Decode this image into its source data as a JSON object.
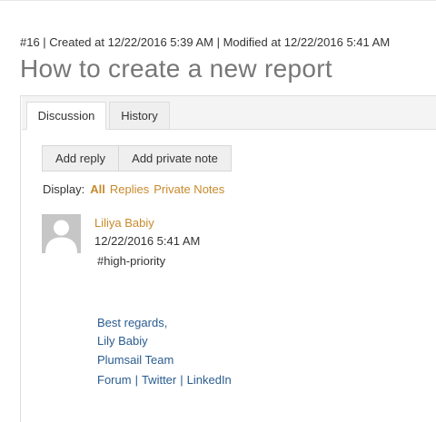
{
  "ticket": {
    "meta": "#16 | Created at 12/22/2016 5:39 AM | Modified at 12/22/2016 5:41 AM",
    "title": "How to create a new report"
  },
  "tabs": [
    {
      "label": "Discussion",
      "active": true
    },
    {
      "label": "History",
      "active": false
    }
  ],
  "actions": {
    "add_reply": "Add reply",
    "add_private_note": "Add private note"
  },
  "filter": {
    "label": "Display:",
    "options": [
      "All",
      "Replies",
      "Private Notes"
    ],
    "selected": "All"
  },
  "comment": {
    "author": "Liliya Babiy",
    "timestamp": "12/22/2016 5:41 AM",
    "body": "#high-priority",
    "signature": {
      "line1": "Best regards,",
      "line2": "Lily Babiy",
      "line3": "Plumsail Team",
      "links": [
        "Forum",
        "Twitter",
        "LinkedIn"
      ],
      "separator": "|"
    }
  },
  "colors": {
    "accent": "#c88a2c",
    "link": "#2a5c8f",
    "title": "#777777"
  },
  "icons": {
    "avatar": "default-user-avatar-icon"
  }
}
